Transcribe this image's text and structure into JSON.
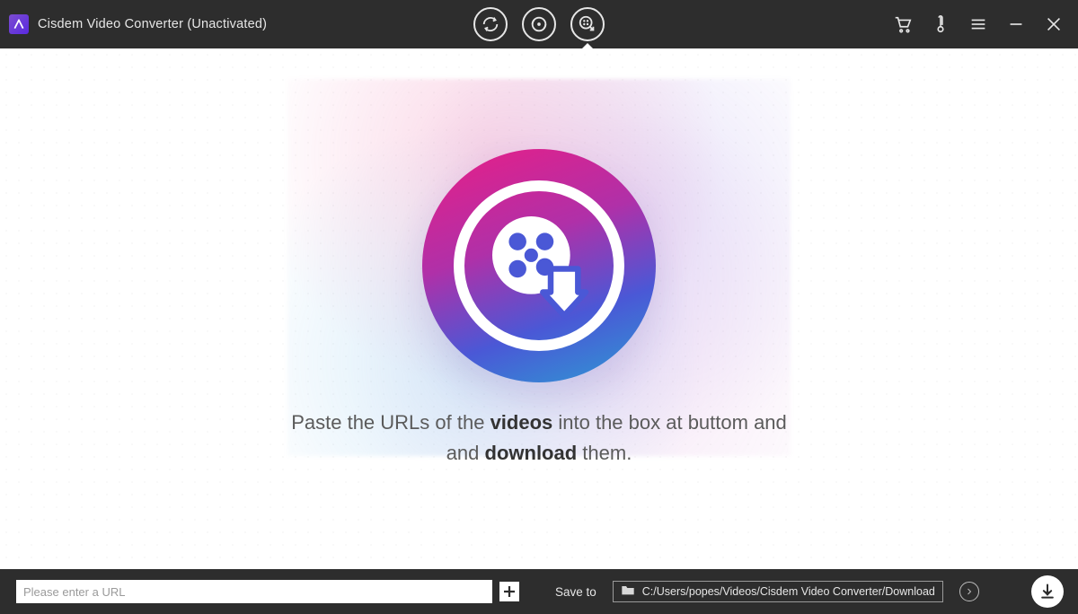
{
  "header": {
    "title": "Cisdem Video Converter (Unactivated)"
  },
  "tabs": {
    "convert": "Convert",
    "rip": "Rip",
    "download": "Download"
  },
  "main": {
    "hint_pre": "Paste the URLs of the ",
    "hint_bold1": "videos",
    "hint_mid": " into the box at buttom and ",
    "hint_bold2": "download",
    "hint_post": " them."
  },
  "bottom": {
    "url_placeholder": "Please enter a URL",
    "save_label": "Save to",
    "save_path": "C:/Users/popes/Videos/Cisdem Video Converter/Download"
  }
}
